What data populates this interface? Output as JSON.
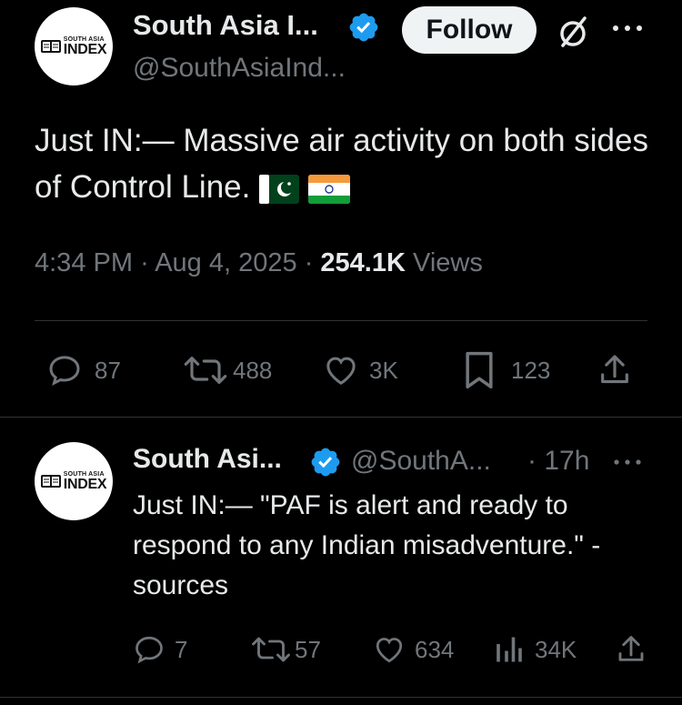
{
  "tweet": {
    "author_name": "South Asia I...",
    "author_handle": "@SouthAsiaInd...",
    "avatar_logo_top": "SOUTH ASIA",
    "avatar_logo_bottom": "INDEX",
    "follow_label": "Follow",
    "text": "Just IN:— Massive air activity on both sides of Control Line.",
    "flags": [
      "pakistan-flag",
      "india-flag"
    ],
    "time": "4:34 PM",
    "date": "Aug 4, 2025",
    "views_count": "254.1K",
    "views_label": "Views",
    "sep": "·",
    "stats": {
      "replies": "87",
      "reposts": "488",
      "likes": "3K",
      "bookmarks": "123"
    }
  },
  "reply": {
    "author_name": "South Asi...",
    "author_handle": "@SouthA...",
    "time_ago": "· 17h",
    "text": "Just IN:— \"PAF is alert and ready to respond to any Indian misadventure.\" - sources",
    "stats": {
      "replies": "7",
      "reposts": "57",
      "likes": "634",
      "views": "34K"
    }
  },
  "colors": {
    "background": "#000000",
    "text": "#e7e9ea",
    "muted": "#71767b",
    "verified": "#1d9bf0",
    "divider": "#2f3336"
  }
}
